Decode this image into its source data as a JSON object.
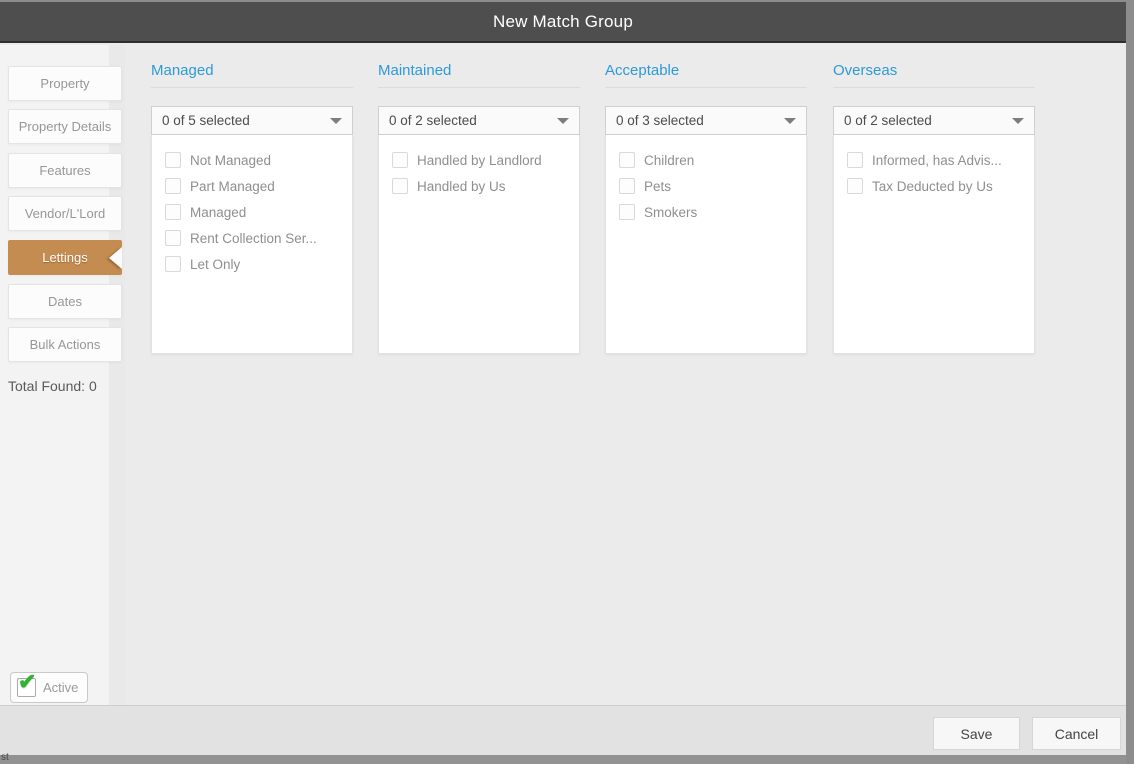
{
  "window": {
    "title": "New Match Group"
  },
  "sidebar": {
    "tabs": [
      {
        "label": "Property",
        "active": false
      },
      {
        "label": "Property Details",
        "active": false
      },
      {
        "label": "Features",
        "active": false
      },
      {
        "label": "Vendor/L'Lord",
        "active": false
      },
      {
        "label": "Lettings",
        "active": true
      },
      {
        "label": "Dates",
        "active": false
      },
      {
        "label": "Bulk Actions",
        "active": false
      }
    ],
    "total_found": "Total Found: 0",
    "active_checkbox": {
      "label": "Active",
      "checked": true
    }
  },
  "columns": [
    {
      "title": "Managed",
      "summary": "0 of 5 selected",
      "options": [
        "Not Managed",
        "Part Managed",
        "Managed",
        "Rent Collection Ser...",
        "Let Only"
      ],
      "checked": [
        false,
        false,
        false,
        false,
        false
      ]
    },
    {
      "title": "Maintained",
      "summary": "0 of 2 selected",
      "options": [
        "Handled by Landlord",
        "Handled by Us"
      ],
      "checked": [
        false,
        false
      ]
    },
    {
      "title": "Acceptable",
      "summary": "0 of 3 selected",
      "options": [
        "Children",
        "Pets",
        "Smokers"
      ],
      "checked": [
        false,
        false,
        false
      ]
    },
    {
      "title": "Overseas",
      "summary": "0 of 2 selected",
      "options": [
        "Informed, has Advis...",
        "Tax Deducted by Us"
      ],
      "checked": [
        false,
        false
      ]
    }
  ],
  "footer": {
    "save_label": "Save",
    "cancel_label": "Cancel"
  },
  "background_window": {
    "clipped_text": "st"
  },
  "colors": {
    "titlebar": "#4e4e4e",
    "accent_blue": "#2e9ad5",
    "active_tab": "#c48c51",
    "check_green": "#2db52d",
    "main_background": "#ebebeb",
    "footer_background": "#e2e2e2"
  }
}
